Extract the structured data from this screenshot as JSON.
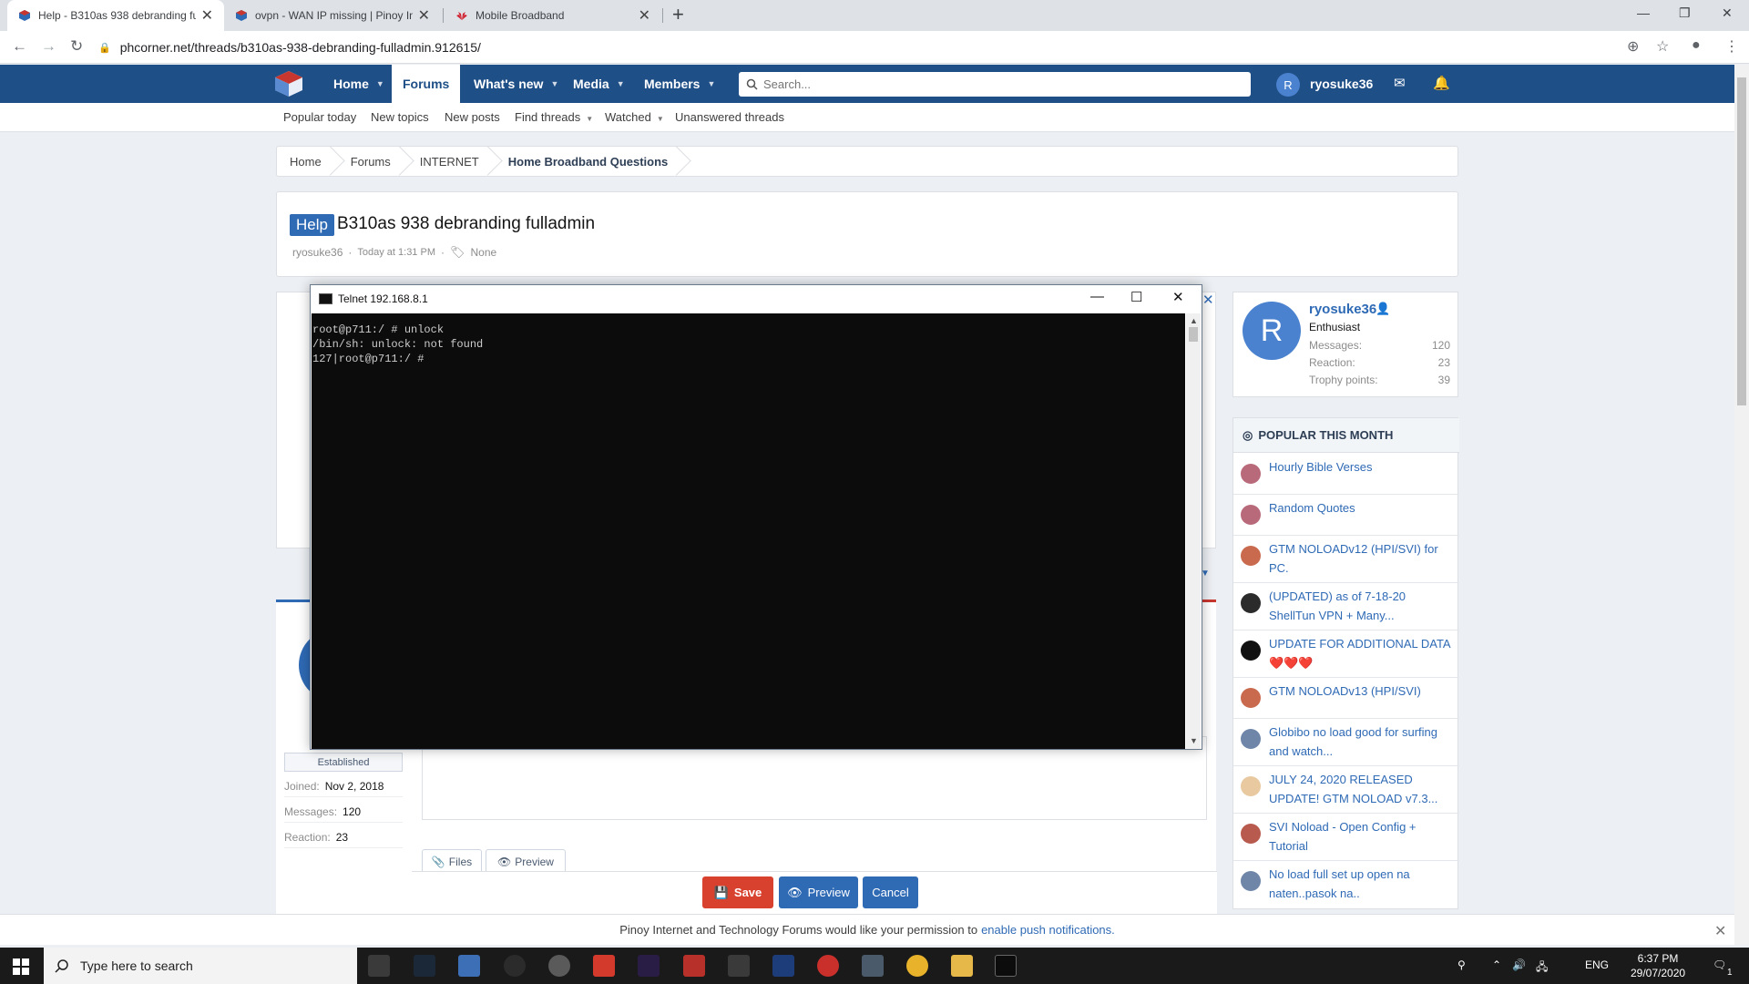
{
  "browser": {
    "tabs": [
      {
        "title": "Help - B310as 938 debranding fu",
        "active": true
      },
      {
        "title": "ovpn - WAN IP missing | Pinoy In",
        "active": false
      },
      {
        "title": "Mobile Broadband",
        "active": false
      }
    ],
    "url": "phcorner.net/threads/b310as-938-debranding-fulladmin.912615/"
  },
  "nav": {
    "items": [
      "Home",
      "Forums",
      "What's new",
      "Media",
      "Members"
    ],
    "search_placeholder": "Search...",
    "user_initial": "R",
    "username": "ryosuke36"
  },
  "subnav": [
    "Popular today",
    "New topics",
    "New posts",
    "Find threads",
    "Watched",
    "Unanswered threads"
  ],
  "breadcrumb": [
    "Home",
    "Forums",
    "INTERNET",
    "Home Broadband Questions"
  ],
  "thread": {
    "prefix": "Help",
    "title": "B310as 938 debranding fulladmin",
    "author": "ryosuke36",
    "sep": "·",
    "time": "Today at 1:31 PM",
    "tag": "None"
  },
  "telnet": {
    "title": "Telnet 192.168.8.1",
    "lines": [
      "root@p711:/ # unlock",
      "/bin/sh: unlock: not found",
      "127|root@p711:/ #"
    ]
  },
  "poster": {
    "badge": "Established",
    "joined_label": "Joined:",
    "joined": "Nov 2, 2018",
    "messages_label": "Messages:",
    "messages": "120",
    "reaction_label": "Reaction:",
    "reaction": "23"
  },
  "editor": {
    "files_label": "Files",
    "preview_tab_label": "Preview",
    "save_label": "Save",
    "preview_label": "Preview",
    "cancel_label": "Cancel"
  },
  "member": {
    "initial": "R",
    "name": "ryosuke36",
    "rank": "Enthusiast",
    "stats": [
      {
        "label": "Messages:",
        "value": "120"
      },
      {
        "label": "Reaction:",
        "value": "23"
      },
      {
        "label": "Trophy points:",
        "value": "39"
      }
    ]
  },
  "popular": {
    "heading": "POPULAR THIS MONTH",
    "items": [
      "Hourly Bible Verses",
      "Random Quotes",
      "GTM NOLOADv12 (HPI/SVI) for PC.",
      "(UPDATED) as of 7-18-20 ShellTun VPN + Many...",
      "UPDATE FOR ADDITIONAL DATA ❤️❤️❤️",
      "GTM NOLOADv13 (HPI/SVI)",
      "Globibo no load good for surfing and watch...",
      "JULY 24, 2020 RELEASED UPDATE! GTM NOLOAD v7.3...",
      "SVI Noload - Open Config + Tutorial",
      "No load full set up open na naten..pasok na.."
    ]
  },
  "push": {
    "text": "Pinoy Internet and Technology Forums would like your permission to",
    "link": "enable push notifications."
  },
  "taskbar": {
    "search_placeholder": "Type here to search",
    "lang": "ENG",
    "time": "6:37 PM",
    "date": "29/07/2020",
    "notif_count": "1"
  }
}
